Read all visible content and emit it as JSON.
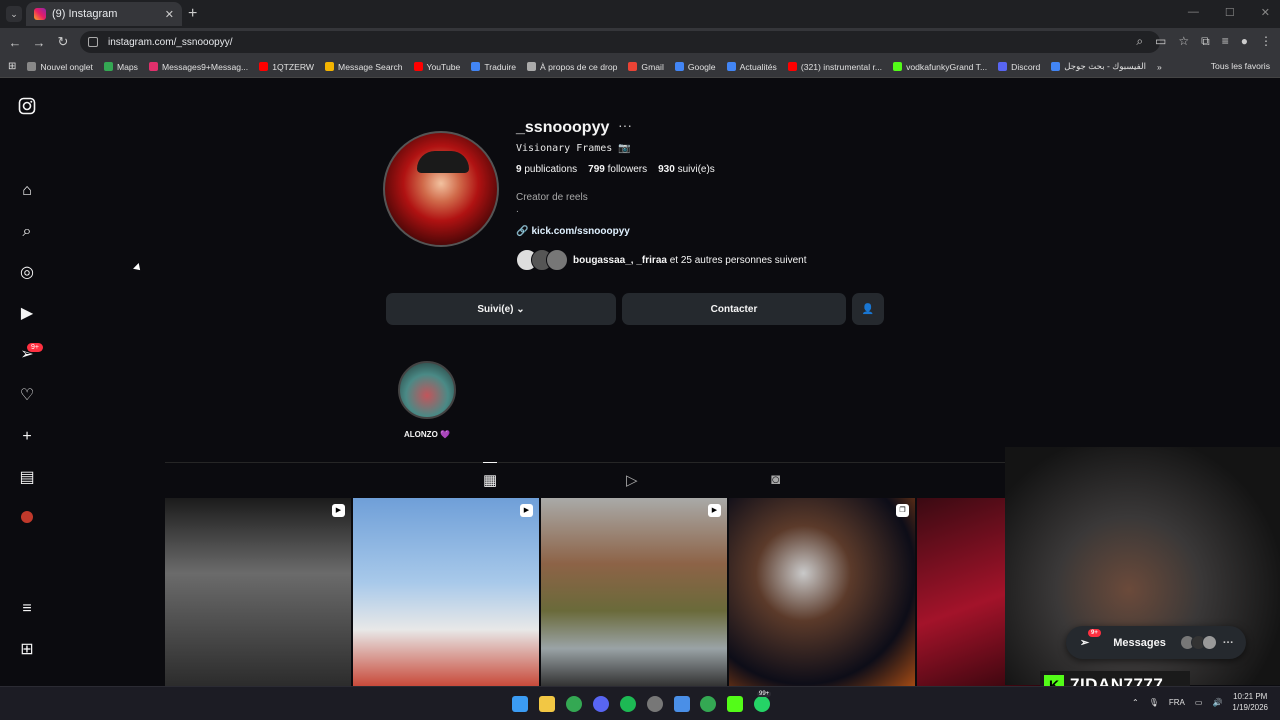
{
  "browser": {
    "tab_title": "(9) Instagram",
    "tab_close": "✕",
    "new_tab": "+",
    "url": "instagram.com/_ssnooopyy/",
    "bookmarks": [
      "Nouvel onglet",
      "Maps",
      "Messages9+Messag...",
      "1QTZERW",
      "Message Search",
      "YouTube",
      "Traduire",
      "À propos de ce drop",
      "Gmail",
      "Google",
      "Actualités",
      "(321) instrumental r...",
      "vodkafunkyGrand T...",
      "Discord",
      "الفيسبوك - بحث جوجل"
    ],
    "bookmarks_more": "»",
    "all_bookmarks": "Tous les favoris"
  },
  "sidebar": {
    "icons": [
      "instagram-logo-icon",
      "home-icon",
      "search-icon",
      "explore-icon",
      "reels-icon",
      "messages-icon",
      "notifications-icon",
      "create-icon",
      "dashboard-icon",
      "profile-icon",
      "menu-icon",
      "apps-icon"
    ],
    "messages_badge": "9+"
  },
  "profile": {
    "username": "_ssnooopyy",
    "more": "···",
    "bio_name": "Visionary Frames 📷",
    "stats": {
      "publications_count": "9",
      "publications_label": "publications",
      "followers_count": "799",
      "followers_label": "followers",
      "following_count": "930",
      "following_label": "suivi(e)s"
    },
    "category": "Creator de reels",
    "bio_dot": ".",
    "link": "kick.com/ssnooopyy",
    "mutual_names": "bougassaa_, _friraa",
    "mutual_rest": "et 25 autres personnes suivent",
    "follow_button": "Suivi(e) ⌄",
    "contact_button": "Contacter",
    "highlight_label": "ALONZO 💜"
  },
  "stream_overlay": {
    "name": "7IDAN7777",
    "k": "K"
  },
  "messages_pill": {
    "label": "Messages",
    "badge": "9+",
    "more": "···"
  },
  "taskbar": {
    "lang": "FRA",
    "time": "10:21 PM",
    "date": "1/19/2026",
    "badge": "99+"
  }
}
